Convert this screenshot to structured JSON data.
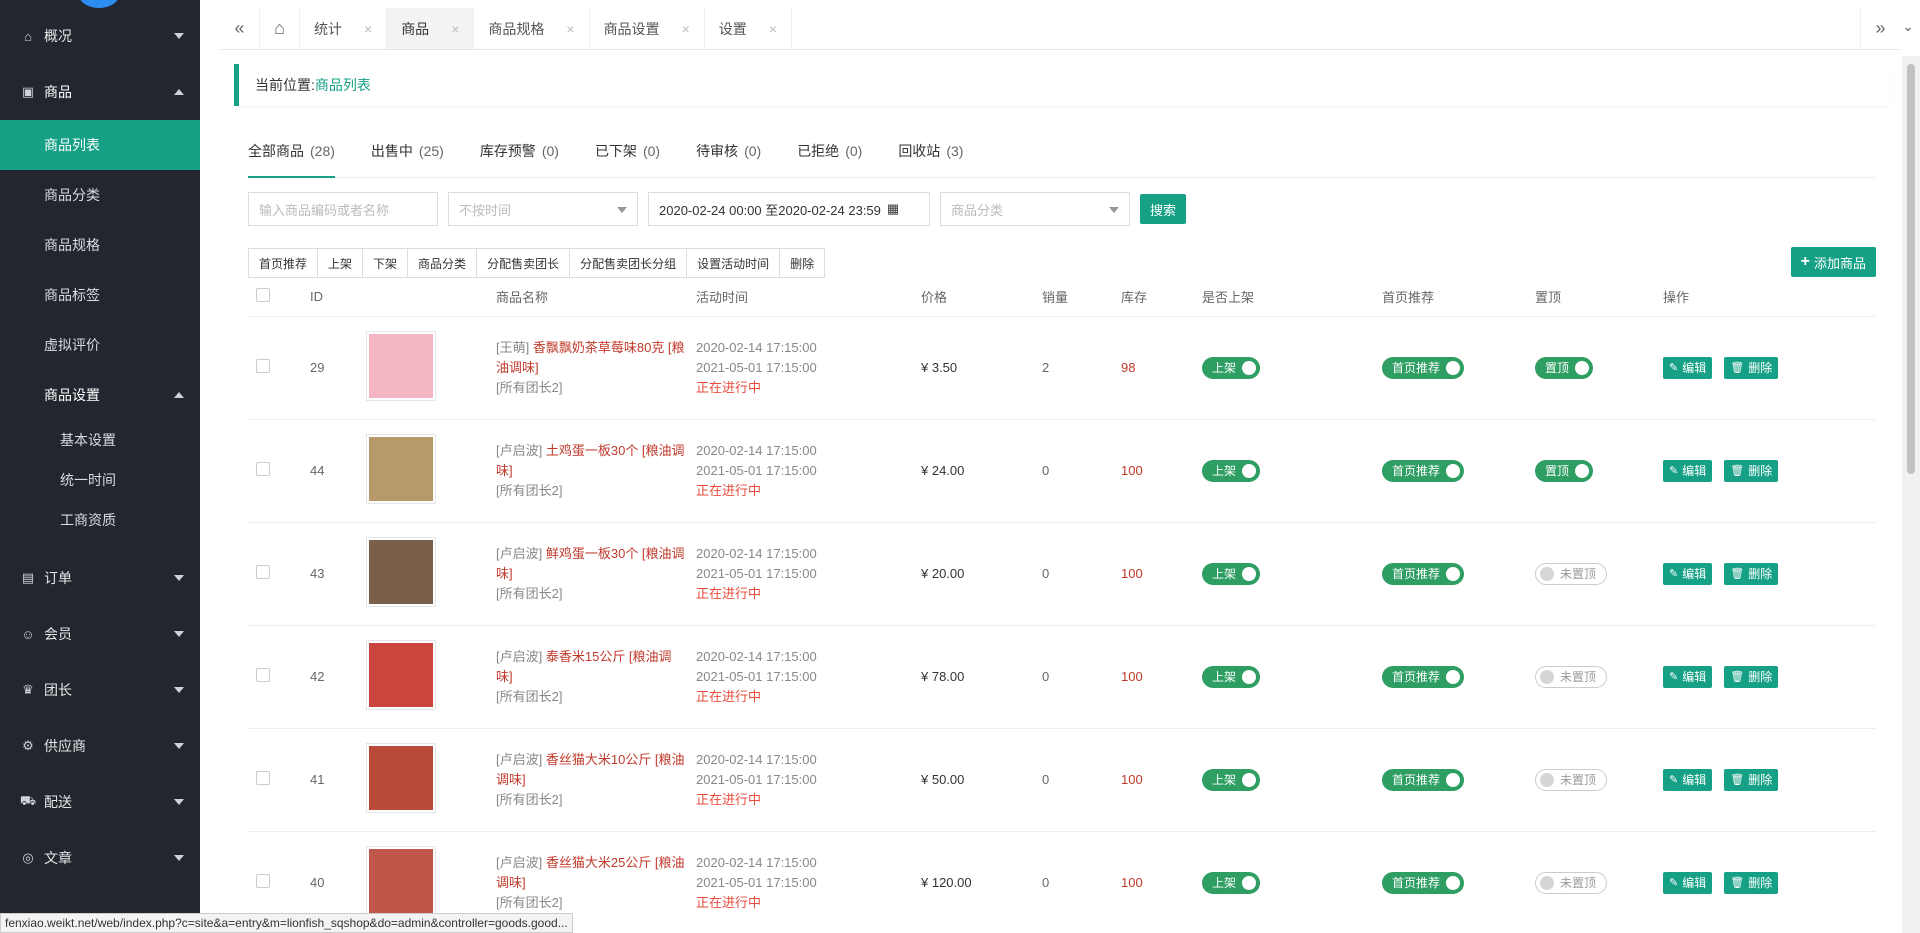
{
  "sidebar": {
    "items": [
      {
        "label": "概况",
        "icon": "home-icon"
      },
      {
        "label": "商品",
        "icon": "shop-icon"
      },
      {
        "label": "订单",
        "icon": "document-icon"
      },
      {
        "label": "会员",
        "icon": "users-icon"
      },
      {
        "label": "团长",
        "icon": "crown-icon"
      },
      {
        "label": "供应商",
        "icon": "user-cog-icon"
      },
      {
        "label": "配送",
        "icon": "truck-icon"
      },
      {
        "label": "文章",
        "icon": "compass-icon"
      }
    ],
    "goods_sub": [
      "商品列表",
      "商品分类",
      "商品规格",
      "商品标签",
      "虚拟评价"
    ],
    "goods_settings": {
      "label": "商品设置",
      "items": [
        "基本设置",
        "统一时间",
        "工商资质"
      ]
    }
  },
  "tabs": [
    {
      "label": "统计"
    },
    {
      "label": "商品"
    },
    {
      "label": "商品规格"
    },
    {
      "label": "商品设置"
    },
    {
      "label": "设置"
    }
  ],
  "breadcrumb": {
    "prefix": "当前位置:",
    "current": "商品列表"
  },
  "filter_tabs": [
    {
      "label": "全部商品",
      "count": "(28)"
    },
    {
      "label": "出售中",
      "count": "(25)"
    },
    {
      "label": "库存预警",
      "count": "(0)"
    },
    {
      "label": "已下架",
      "count": "(0)"
    },
    {
      "label": "待审核",
      "count": "(0)"
    },
    {
      "label": "已拒绝",
      "count": "(0)"
    },
    {
      "label": "回收站",
      "count": "(3)"
    }
  ],
  "search": {
    "keyword_placeholder": "输入商品编码或者名称",
    "time_select": "不按时间",
    "date_range": "2020-02-24 00:00 至2020-02-24 23:59",
    "category_select": "商品分类",
    "search_button": "搜索"
  },
  "actions": [
    "首页推荐",
    "上架",
    "下架",
    "商品分类",
    "分配售卖团长",
    "分配售卖团长分组",
    "设置活动时间",
    "删除"
  ],
  "add_button": "添加商品",
  "columns": {
    "id": "ID",
    "name": "商品名称",
    "time": "活动时间",
    "price": "价格",
    "sales": "销量",
    "stock": "库存",
    "onsale": "是否上架",
    "recommend": "首页推荐",
    "top": "置顶",
    "ops": "操作"
  },
  "labels": {
    "onsale_on": "上架",
    "recommend_on": "首页推荐",
    "top_on": "置顶",
    "top_off": "未置顶",
    "edit": "编辑",
    "delete": "删除"
  },
  "rows": [
    {
      "id": "29",
      "seller": "[王萌]",
      "title": "香飘飘奶茶草莓味80克 [粮油调味]",
      "group": "[所有团长2]",
      "start": "2020-02-14 17:15:00",
      "end": "2021-05-01 17:15:00",
      "status": "正在进行中",
      "price": "¥ 3.50",
      "sales": "2",
      "stock": "98",
      "top": true,
      "thumb_color": "#f4b6c2"
    },
    {
      "id": "44",
      "seller": "[卢启波]",
      "title": "土鸡蛋一板30个 [粮油调味]",
      "group": "[所有团长2]",
      "start": "2020-02-14 17:15:00",
      "end": "2021-05-01 17:15:00",
      "status": "正在进行中",
      "price": "¥ 24.00",
      "sales": "0",
      "stock": "100",
      "top": true,
      "thumb_color": "#b89a6a"
    },
    {
      "id": "43",
      "seller": "[卢启波]",
      "title": "鲜鸡蛋一板30个 [粮油调味]",
      "group": "[所有团长2]",
      "start": "2020-02-14 17:15:00",
      "end": "2021-05-01 17:15:00",
      "status": "正在进行中",
      "price": "¥ 20.00",
      "sales": "0",
      "stock": "100",
      "top": false,
      "thumb_color": "#7a5f4a"
    },
    {
      "id": "42",
      "seller": "[卢启波]",
      "title": "泰香米15公斤 [粮油调味]",
      "group": "[所有团长2]",
      "start": "2020-02-14 17:15:00",
      "end": "2021-05-01 17:15:00",
      "status": "正在进行中",
      "price": "¥ 78.00",
      "sales": "0",
      "stock": "100",
      "top": false,
      "thumb_color": "#c9453e"
    },
    {
      "id": "41",
      "seller": "[卢启波]",
      "title": "香丝猫大米10公斤 [粮油调味]",
      "group": "[所有团长2]",
      "start": "2020-02-14 17:15:00",
      "end": "2021-05-01 17:15:00",
      "status": "正在进行中",
      "price": "¥ 50.00",
      "sales": "0",
      "stock": "100",
      "top": false,
      "thumb_color": "#b94a3a"
    },
    {
      "id": "40",
      "seller": "[卢启波]",
      "title": "香丝猫大米25公斤 [粮油调味]",
      "group": "[所有团长2]",
      "start": "2020-02-14 17:15:00",
      "end": "2021-05-01 17:15:00",
      "status": "正在进行中",
      "price": "¥ 120.00",
      "sales": "0",
      "stock": "100",
      "top": false,
      "thumb_color": "#c0564a"
    }
  ],
  "status_url": "fenxiao.weikt.net/web/index.php?c=site&a=entry&m=lionfish_sqshop&do=admin&controller=goods.good..."
}
